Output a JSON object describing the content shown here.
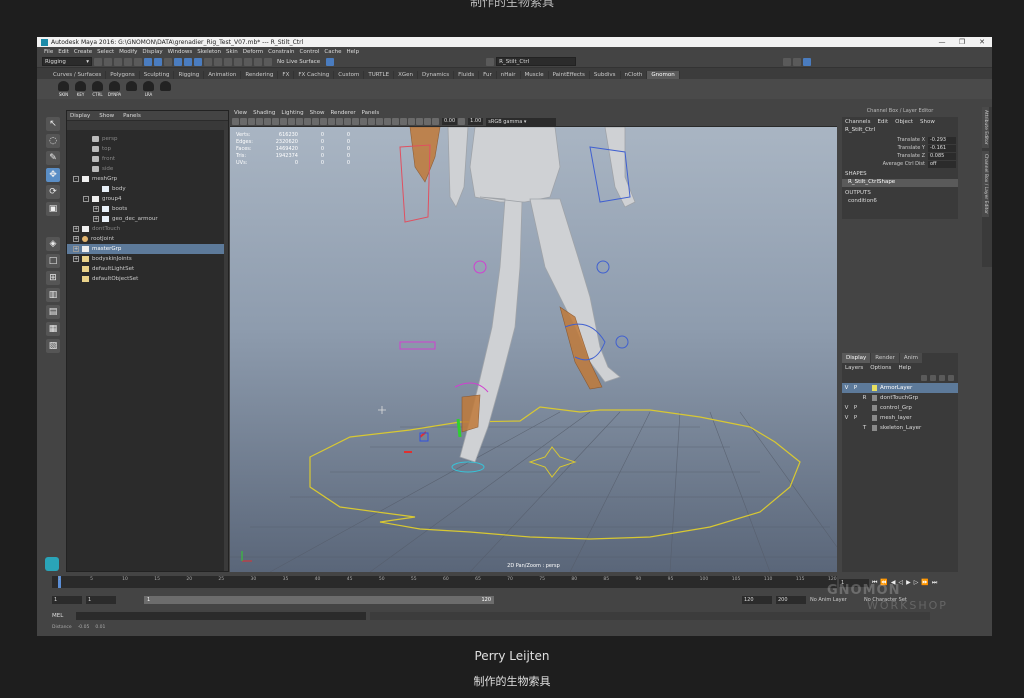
{
  "captions": {
    "top_partial": "制作的生物索具",
    "name": "Perry Leijten",
    "subtitle": "制作的生物索具"
  },
  "window": {
    "title": "Autodesk Maya 2016: G:\\GNOMON\\DATA\\grenadier_Rig_Test_V07.mb*  ---  R_Stilt_Ctrl",
    "controls": [
      "—",
      "❐",
      "✕"
    ]
  },
  "menubar": [
    "File",
    "Edit",
    "Create",
    "Select",
    "Modify",
    "Display",
    "Windows",
    "Skeleton",
    "Skin",
    "Deform",
    "Constrain",
    "Control",
    "Cache",
    "Help"
  ],
  "status_line": {
    "menu_set": "Rigging",
    "live_surface": "No Live Surface",
    "selection_field": "R_Stilt_Ctrl"
  },
  "shelf_tabs": [
    "Curves / Surfaces",
    "Polygons",
    "Sculpting",
    "Rigging",
    "Animation",
    "Rendering",
    "FX",
    "FX Caching",
    "Custom",
    "TURTLE",
    "XGen",
    "Dynamics",
    "Fluids",
    "Fur",
    "nHair",
    "Muscle",
    "PaintEffects",
    "Subdivs",
    "nCloth",
    "Gnomon"
  ],
  "shelf_active": "Gnomon",
  "shelf_buttons": [
    "SKIN",
    "KEY",
    "CTRL",
    "DYNPA",
    "",
    "LRA",
    ""
  ],
  "outliner": {
    "menu": [
      "Display",
      "Show",
      "Panels"
    ],
    "rows": [
      {
        "label": "persp",
        "kind": "cam",
        "indent": 1,
        "dim": true
      },
      {
        "label": "top",
        "kind": "cam",
        "indent": 1,
        "dim": true
      },
      {
        "label": "front",
        "kind": "cam",
        "indent": 1,
        "dim": true
      },
      {
        "label": "side",
        "kind": "cam",
        "indent": 1,
        "dim": true
      },
      {
        "label": "meshGrp",
        "kind": "grp",
        "indent": 0,
        "exp": "-"
      },
      {
        "label": "body",
        "kind": "mesh",
        "indent": 2
      },
      {
        "label": "group4",
        "kind": "grp",
        "indent": 1,
        "exp": "-"
      },
      {
        "label": "boots",
        "kind": "mesh",
        "indent": 2,
        "exp": "+"
      },
      {
        "label": "geo_dec_armour",
        "kind": "mesh",
        "indent": 2,
        "exp": "+"
      },
      {
        "label": "dontTouch",
        "kind": "grp",
        "indent": 0,
        "exp": "+",
        "dim": true
      },
      {
        "label": "rootJoint",
        "kind": "jnt",
        "indent": 0,
        "exp": "+"
      },
      {
        "label": "masterGrp",
        "kind": "grp",
        "indent": 0,
        "exp": "+",
        "sel": true
      },
      {
        "label": "bodyskinJoints",
        "kind": "set",
        "indent": 0,
        "exp": "+"
      },
      {
        "label": "defaultLightSet",
        "kind": "set",
        "indent": 0
      },
      {
        "label": "defaultObjectSet",
        "kind": "set",
        "indent": 0
      }
    ]
  },
  "viewport": {
    "menu": [
      "View",
      "Shading",
      "Lighting",
      "Show",
      "Renderer",
      "Panels"
    ],
    "field_a": "0.00",
    "field_b": "1.00",
    "gamma": "sRGB gamma",
    "hud": [
      {
        "label": "Verts:",
        "v1": "616230",
        "v2": "0",
        "v3": "0"
      },
      {
        "label": "Edges:",
        "v1": "2320620",
        "v2": "0",
        "v3": "0"
      },
      {
        "label": "Faces:",
        "v1": "1469420",
        "v2": "0",
        "v3": "0"
      },
      {
        "label": "Tris:",
        "v1": "1942374",
        "v2": "0",
        "v3": "0"
      },
      {
        "label": "UVs:",
        "v1": "0",
        "v2": "0",
        "v3": "0"
      }
    ],
    "camera_label": "2D Pan/Zoom : persp"
  },
  "channel_box": {
    "title": "Channel Box / Layer Editor",
    "menu": [
      "Channels",
      "Edit",
      "Object",
      "Show"
    ],
    "object": "R_Stilt_Ctrl",
    "attrs": [
      {
        "name": "Translate X",
        "value": "-0.293"
      },
      {
        "name": "Translate Y",
        "value": "-0.161"
      },
      {
        "name": "Translate Z",
        "value": "0.085"
      },
      {
        "name": "Average Ctrl Dist",
        "value": "off"
      }
    ],
    "shapes_label": "SHAPES",
    "shape_name": "R_Stilt_CtrlShape",
    "outputs_label": "OUTPUTS",
    "output_name": "condition6"
  },
  "layer_editor": {
    "tabs": [
      "Display",
      "Render",
      "Anim"
    ],
    "menu": [
      "Layers",
      "Options",
      "Help"
    ],
    "layers": [
      {
        "v": "V",
        "p": "P",
        "r": "",
        "name": "ArmorLayer",
        "sel": true,
        "color": "#e8e060"
      },
      {
        "v": "",
        "p": "",
        "r": "R",
        "name": "dontTouchGrp",
        "sel": false,
        "color": "#8a8a8a"
      },
      {
        "v": "V",
        "p": "P",
        "r": "",
        "name": "control_Grp",
        "sel": false,
        "color": "#8a8a8a"
      },
      {
        "v": "V",
        "p": "P",
        "r": "",
        "name": "mesh_layer",
        "sel": false,
        "color": "#8a8a8a"
      },
      {
        "v": "",
        "p": "",
        "r": "T",
        "name": "skeleton_Layer",
        "sel": false,
        "color": "#8a8a8a"
      }
    ]
  },
  "side_tabs": [
    "Attribute Editor",
    "Channel Box / Layer Editor"
  ],
  "timeline": {
    "ticks": [
      "1",
      "5",
      "10",
      "15",
      "20",
      "25",
      "30",
      "35",
      "40",
      "45",
      "50",
      "55",
      "60",
      "65",
      "70",
      "75",
      "80",
      "85",
      "90",
      "95",
      "100",
      "105",
      "110",
      "115",
      "120"
    ],
    "current_frame": "1"
  },
  "range": {
    "start": "1",
    "inner_start": "1",
    "slider_start": "1",
    "slider_end": "120",
    "end": "120",
    "outer_end": "200",
    "anim_layer": "No Anim Layer",
    "char_set": "No Character Set"
  },
  "command_line": {
    "label": "MEL"
  },
  "help_line": {
    "label": "Distance",
    "v1": "-0.05",
    "v2": "0.01"
  },
  "watermark": {
    "line1": "GNOMON",
    "line2": "WORKSHOP"
  }
}
